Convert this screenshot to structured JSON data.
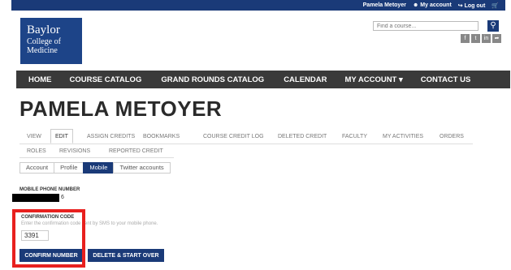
{
  "topbar": {
    "user_name": "Pamela Metoyer",
    "my_account": "My account",
    "logout": "Log out"
  },
  "logo": {
    "line1": "Baylor",
    "line2": "College of",
    "line3": "Medicine"
  },
  "search": {
    "placeholder": "Find a course..."
  },
  "nav": {
    "items": [
      "HOME",
      "COURSE CATALOG",
      "GRAND ROUNDS CATALOG",
      "CALENDAR",
      "MY ACCOUNT",
      "CONTACT US"
    ]
  },
  "page_title": "PAMELA METOYER",
  "tabs": [
    "VIEW",
    "EDIT",
    "ASSIGN CREDITS",
    "BOOKMARKS",
    "COURSE CREDIT LOG",
    "DELETED CREDIT",
    "FACULTY",
    "MY ACTIVITIES",
    "ORDERS",
    "ROLES",
    "REVISIONS",
    "REPORTED CREDIT"
  ],
  "subtabs": [
    "Account",
    "Profile",
    "Mobile",
    "Twitter accounts"
  ],
  "form": {
    "phone_label": "MOBILE PHONE NUMBER",
    "phone_tail": "6",
    "code_label": "CONFIRMATION CODE",
    "code_desc": "Enter the confirmation code sent by SMS to your mobile phone.",
    "code_value": "3391",
    "confirm_button": "CONFIRM NUMBER",
    "delete_button": "DELETE & START OVER"
  },
  "colors": {
    "brand_blue": "#1a3a78",
    "nav_dark": "#3a3a3a",
    "highlight_red": "#e8201e"
  }
}
